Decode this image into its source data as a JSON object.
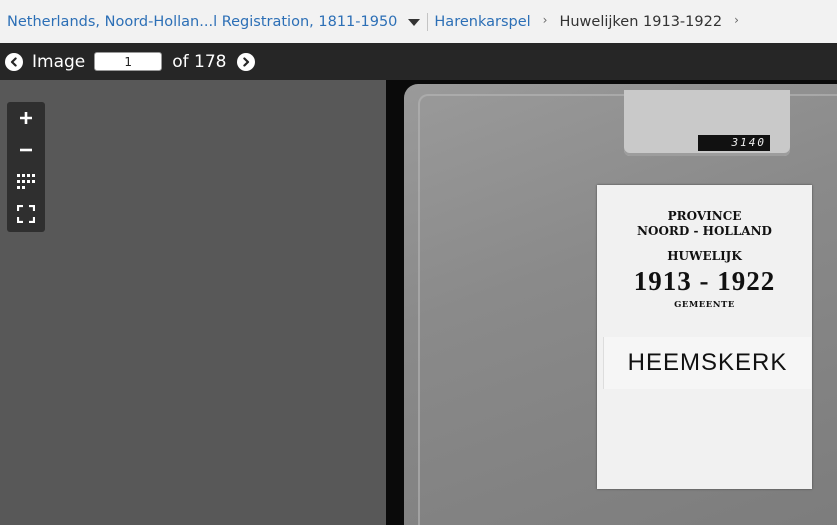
{
  "breadcrumb": {
    "collection": "Netherlands, Noord-Hollan...l Registration, 1811-1950",
    "place": "Harenkarspel",
    "current": "Huwelijken 1913-1922"
  },
  "toolbar": {
    "image_label": "Image",
    "page_value": "1",
    "of_label": "of 178"
  },
  "zoom_controls": {
    "zoom_in": "+",
    "zoom_out": "−"
  },
  "document": {
    "tab_number": "3140",
    "province_line1": "PROVINCE",
    "province_line2": "NOORD - HOLLAND",
    "record_type": "HUWELIJK",
    "years": "1913 - 1922",
    "gemeente_label": "GEMEENTE",
    "town": "HEEMSKERK"
  },
  "colors": {
    "link": "#2c6fb6",
    "toolbar_bg": "#262626",
    "viewer_bg": "#585858"
  }
}
